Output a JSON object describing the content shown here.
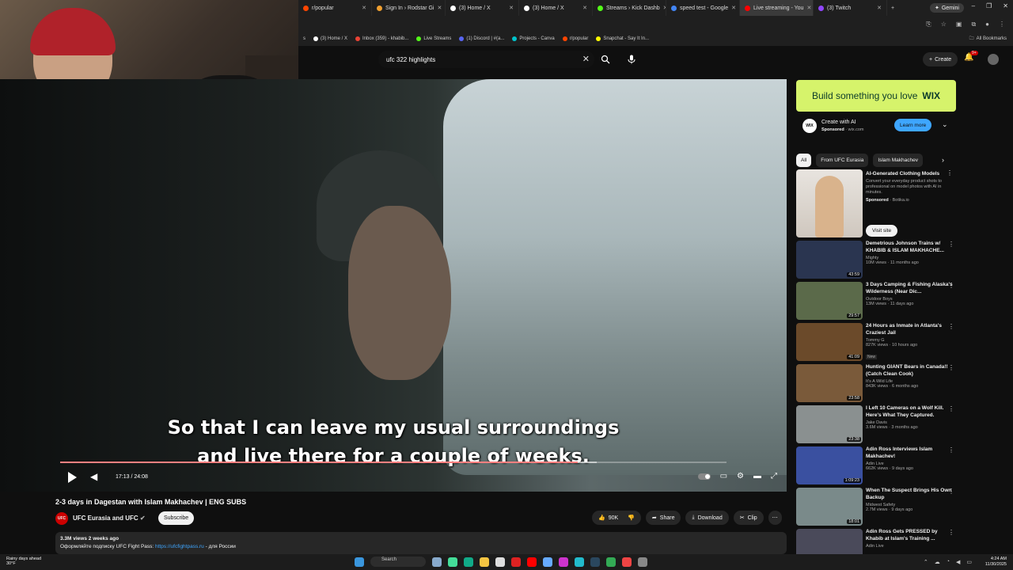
{
  "browser": {
    "tabs": [
      {
        "label": "r/popular",
        "color": "#ff4500",
        "active": false
      },
      {
        "label": "Sign In › Rodstar Gi",
        "color": "#f0a030",
        "active": false
      },
      {
        "label": "(3) Home / X",
        "color": "#ffffff",
        "active": false
      },
      {
        "label": "(3) Home / X",
        "color": "#ffffff",
        "active": false
      },
      {
        "label": "Streams › Kick Dashb",
        "color": "#53fc18",
        "active": false
      },
      {
        "label": "speed test - Google",
        "color": "#4285f4",
        "active": false
      },
      {
        "label": "Live streaming - You",
        "color": "#ff0000",
        "active": true
      },
      {
        "label": "(3) Twitch",
        "color": "#9146ff",
        "active": false
      }
    ],
    "gemini_label": "Gemini",
    "bookmarks": [
      {
        "label": "(3) Home / X",
        "color": "#ffffff"
      },
      {
        "label": "Inbox (359) - khabib...",
        "color": "#ea4335"
      },
      {
        "label": "Live Streams",
        "color": "#53fc18"
      },
      {
        "label": "(1) Discord | #(a...",
        "color": "#5865f2"
      },
      {
        "label": "Projects - Canva",
        "color": "#00c4cc"
      },
      {
        "label": "r/popular",
        "color": "#ff4500"
      },
      {
        "label": "Snapchat - Say It In...",
        "color": "#fffc00"
      }
    ],
    "all_bookmarks": "All Bookmarks",
    "partial_bookmark": "s",
    "partial_bookmark2": "(3) Home / X"
  },
  "youtube": {
    "search_value": "ufc 322 highlights",
    "create_label": "Create",
    "notif_count": "9+"
  },
  "video": {
    "subtitle_line1": "So that I can leave my usual surroundings",
    "subtitle_line2": "and live there for a couple of weeks.",
    "time": "17:13 / 24:08",
    "progress": 0.777,
    "buffered": 0.805,
    "title": "2-3 days in Dagestan with Islam Makhachev | ENG SUBS",
    "channel": "UFC Eurasia and UFC",
    "channel_avatar_text": "UFC",
    "subscribe_label": "Subscribe",
    "likes": "90K",
    "share_label": "Share",
    "download_label": "Download",
    "clip_label": "Clip",
    "views_date": "3.3M views  2 weeks ago",
    "description_prefix": "Оформляйте подписку UFC Fight Pass: ",
    "description_link": "https://ufcfightpass.ru",
    "description_suffix": " - для России"
  },
  "ad": {
    "banner_text": "Build something you love",
    "banner_brand": "WIX",
    "title": "Create with AI",
    "sponsored": "Sponsored",
    "domain": "wix.com",
    "learn_more": "Learn more",
    "logo_text": "WIX"
  },
  "chips": [
    "All",
    "From UFC Eurasia",
    "Islam Makhachev"
  ],
  "sponsored_video": {
    "title": "AI-Generated Clothing Models",
    "desc": "Convert your everyday product shots to professional on model photos with AI in minutes.",
    "sponsored": "Sponsored",
    "advertiser": "Botika.io",
    "visit_label": "Visit site"
  },
  "recommendations": [
    {
      "title": "Demetrious Johnson Trains w/ KHABIB & ISLAM MAKHACHE...",
      "channel": "Mighty",
      "meta": "10M views · 11 months ago",
      "duration": "43:59",
      "color": "#2a3550",
      "new": ""
    },
    {
      "title": "3 Days Camping & Fishing Alaska's Wilderness (Near Dic...",
      "channel": "Outdoor Boys",
      "meta": "13M views · 11 days ago",
      "duration": "29:57",
      "color": "#5b6a4a",
      "new": ""
    },
    {
      "title": "24 Hours as Inmate in Atlanta's Craziest Jail",
      "channel": "Tommy G",
      "meta": "827K views · 10 hours ago",
      "duration": "41:09",
      "color": "#6b4a2a",
      "new": "New"
    },
    {
      "title": "Hunting GIANT Bears in Canada!! (Catch Clean Cook)",
      "channel": "It's A Wild Life",
      "meta": "843K views · 6 months ago",
      "duration": "23:58",
      "color": "#7a5a3a",
      "new": ""
    },
    {
      "title": "I Left 10 Cameras on a Wolf Kill. Here's What They Captured.",
      "channel": "Jake Davis",
      "meta": "3.6M views · 3 months ago",
      "duration": "23:38",
      "color": "#8a9090",
      "new": ""
    },
    {
      "title": "Adin Ross Interviews Islam Makhachev!",
      "channel": "Adin Live",
      "meta": "662K views · 9 days ago",
      "duration": "1:09:23",
      "color": "#3a50a0",
      "new": ""
    },
    {
      "title": "When The Suspect Brings His Own Backup",
      "channel": "Midwest Safety",
      "meta": "2.7M views · 9 days ago",
      "duration": "18:01",
      "color": "#7a8a8a",
      "new": ""
    },
    {
      "title": "Adin Ross Gets PRESSED by Khabib at Islam's Training ...",
      "channel": "Adin Live",
      "meta": "",
      "duration": "",
      "color": "#4a4a5a",
      "new": ""
    }
  ],
  "taskbar": {
    "weather_line1": "Rainy days ahead",
    "weather_line2": "30°F",
    "search_label": "Search",
    "time": "4:24 AM",
    "date": "11/30/2025"
  }
}
